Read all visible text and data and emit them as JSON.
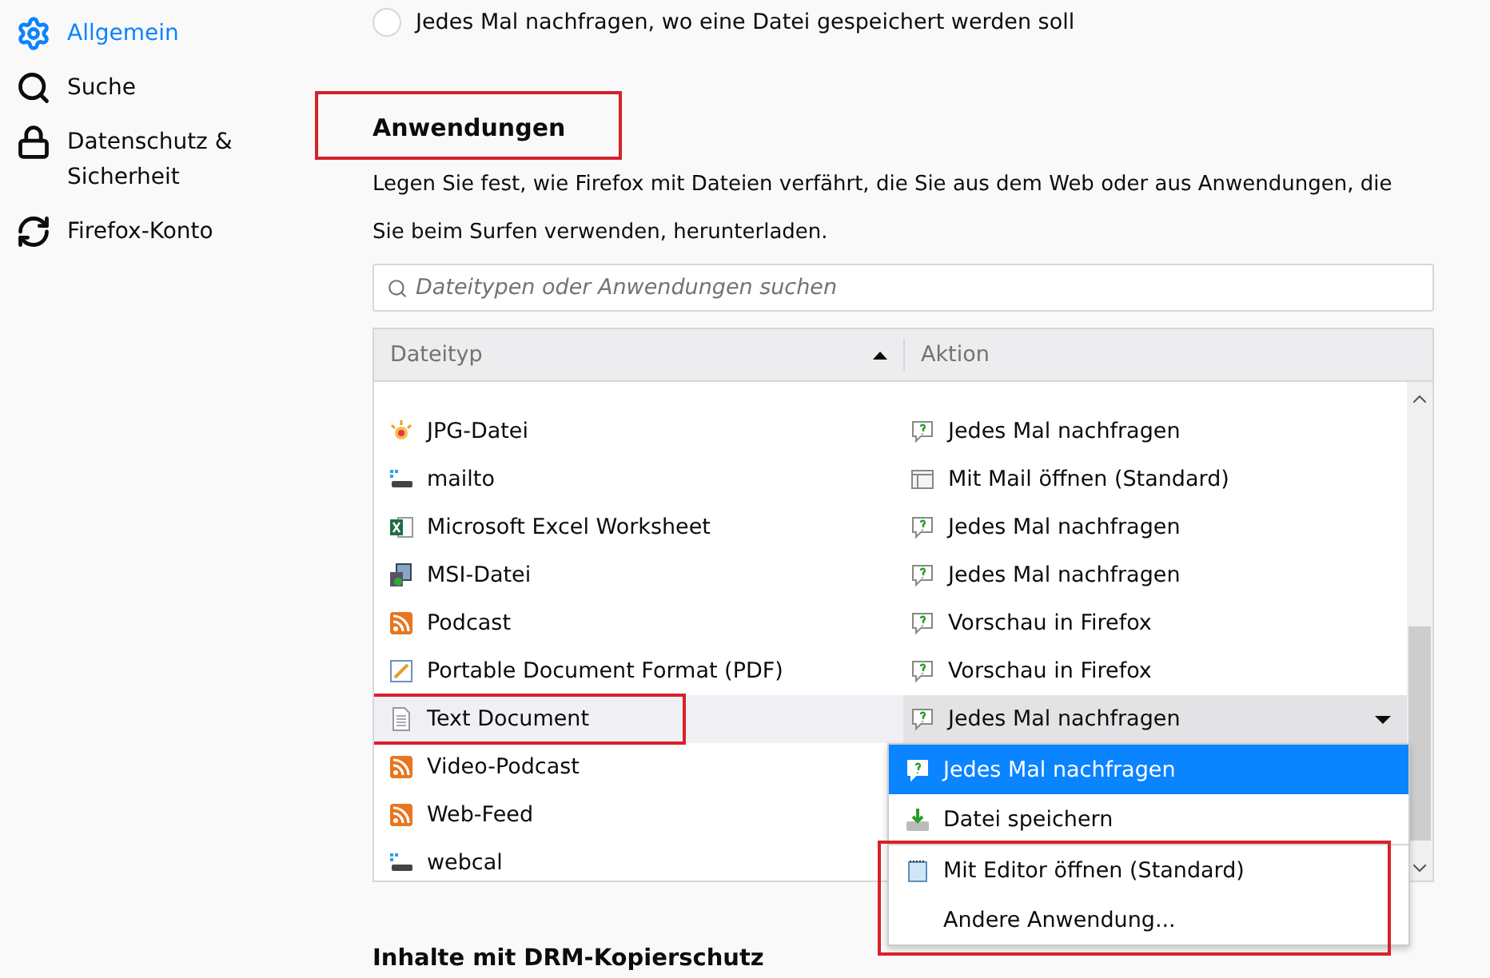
{
  "sidebar": {
    "items": [
      {
        "label": "Allgemein",
        "kind": "gear",
        "selected": true
      },
      {
        "label": "Suche",
        "kind": "search",
        "selected": false
      },
      {
        "label": "Datenschutz & Sicherheit",
        "kind": "lock",
        "selected": false
      },
      {
        "label": "Firefox-Konto",
        "kind": "sync",
        "selected": false
      }
    ]
  },
  "download_option": {
    "label": "Jedes Mal nachfragen, wo eine Datei gespeichert werden soll",
    "selected": false
  },
  "section": {
    "title": "Anwendungen",
    "highlighted": true,
    "description": "Legen Sie fest, wie Firefox mit Dateien verfährt, die Sie aus dem Web oder aus Anwendungen, die Sie beim Surfen verwenden, herunterladen."
  },
  "search": {
    "placeholder": "Dateitypen oder Anwendungen suchen"
  },
  "table": {
    "columns": [
      {
        "label": "Dateityp",
        "sorted": true
      },
      {
        "label": "Aktion"
      }
    ],
    "rows": [
      {
        "type": "JPG-Datei",
        "kind": "image",
        "action": {
          "label": "Jedes Mal nachfragen",
          "kind": "ask"
        },
        "selected": false,
        "highlighted": false
      },
      {
        "type": "mailto",
        "kind": "link",
        "action": {
          "label": "Mit Mail öffnen (Standard)",
          "kind": "mail"
        },
        "selected": false,
        "highlighted": false
      },
      {
        "type": "Microsoft Excel Worksheet",
        "kind": "spreadsheet",
        "action": {
          "label": "Jedes Mal nachfragen",
          "kind": "ask"
        },
        "selected": false,
        "highlighted": false
      },
      {
        "type": "MSI-Datei",
        "kind": "installer",
        "action": {
          "label": "Jedes Mal nachfragen",
          "kind": "ask"
        },
        "selected": false,
        "highlighted": false
      },
      {
        "type": "Podcast",
        "kind": "feed",
        "action": {
          "label": "Vorschau in Firefox",
          "kind": "ask"
        },
        "selected": false,
        "highlighted": false
      },
      {
        "type": "Portable Document Format (PDF)",
        "kind": "pdf",
        "action": {
          "label": "Vorschau in Firefox",
          "kind": "ask"
        },
        "selected": false,
        "highlighted": false
      },
      {
        "type": "Text Document",
        "kind": "document",
        "action": {
          "label": "Jedes Mal nachfragen",
          "kind": "ask"
        },
        "selected": true,
        "highlighted": true
      },
      {
        "type": "Video-Podcast",
        "kind": "feed",
        "selected": false,
        "highlighted": false
      },
      {
        "type": "Web-Feed",
        "kind": "feed",
        "selected": false,
        "highlighted": false
      },
      {
        "type": "webcal",
        "kind": "link",
        "selected": false,
        "highlighted": false
      }
    ]
  },
  "dropdown": {
    "options": [
      {
        "label": "Jedes Mal nachfragen",
        "kind": "ask",
        "selected": true,
        "highlighted": false
      },
      {
        "label": "Datei speichern",
        "kind": "save",
        "selected": false,
        "highlighted": false
      },
      {
        "label": "Mit Editor öffnen (Standard)",
        "kind": "editor",
        "selected": false,
        "highlighted": true
      },
      {
        "label": "Andere Anwendung...",
        "kind": "none",
        "selected": false,
        "highlighted": true
      }
    ]
  },
  "next_section": {
    "title": "Inhalte mit DRM-Kopierschutz"
  }
}
